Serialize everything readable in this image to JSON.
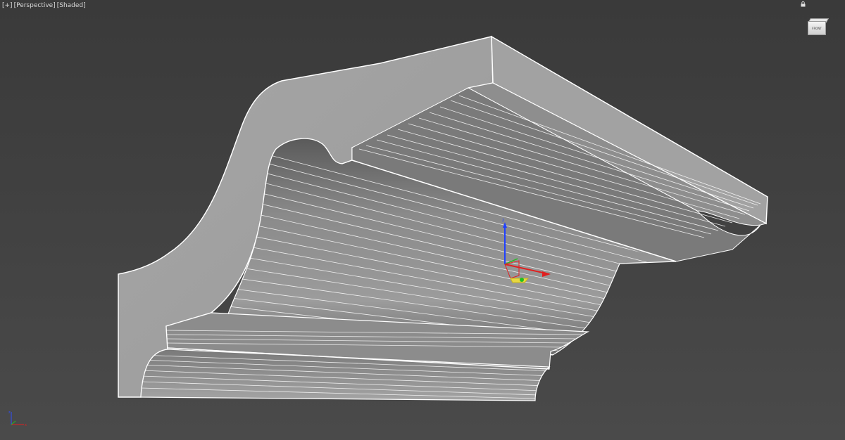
{
  "viewport": {
    "label_plus": "[+]",
    "label_view": "[Perspective]",
    "label_mode": "[Shaded]"
  },
  "viewcube": {
    "face_label": "FRONT"
  },
  "colors": {
    "background": "#3f3f3f",
    "model_face": "#9a9a9a",
    "wire_edge": "#ffffff",
    "gizmo_x": "#e02020",
    "gizmo_y": "#20c020",
    "gizmo_z": "#2040ff",
    "gizmo_plane": "#e8d840"
  },
  "icons": [
    "lock-icon",
    "viewcube-icon",
    "world-axis-icon",
    "transform-gizmo-icon"
  ]
}
